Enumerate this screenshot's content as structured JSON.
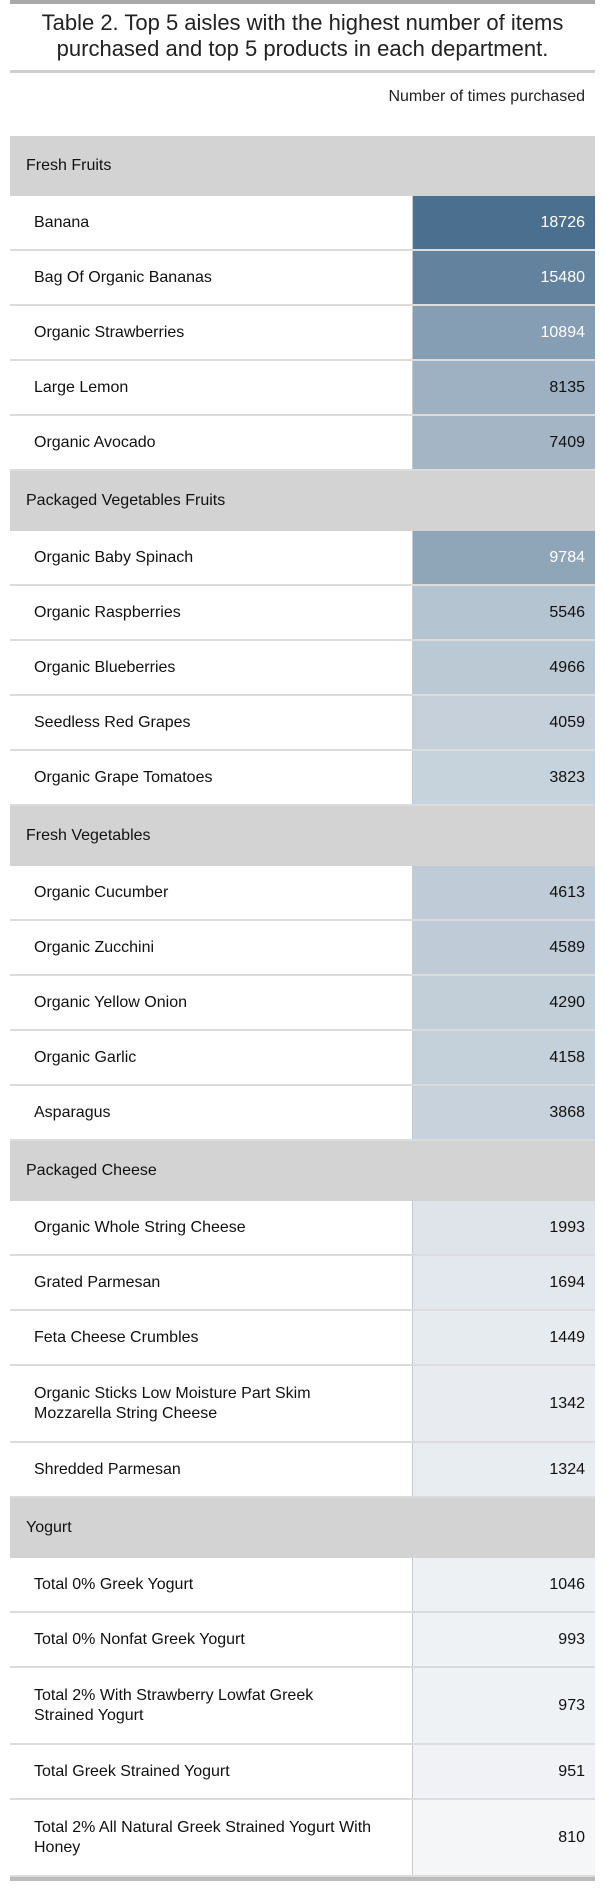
{
  "chart_data": {
    "type": "table",
    "title": "Table 2. Top 5 aisles with the highest number of items purchased and top 5 products in each department.",
    "value_header": "Number of times purchased",
    "value_min": 810,
    "value_max": 18726,
    "colors": {
      "low": "#f4f6f8",
      "high": "#4a6f8f",
      "group_band": "#d3d3d3"
    },
    "groups": [
      {
        "name": "Fresh Fruits",
        "rows": [
          {
            "product": "Banana",
            "value": 18726
          },
          {
            "product": "Bag Of Organic Bananas",
            "value": 15480
          },
          {
            "product": "Organic Strawberries",
            "value": 10894
          },
          {
            "product": "Large Lemon",
            "value": 8135
          },
          {
            "product": "Organic Avocado",
            "value": 7409
          }
        ]
      },
      {
        "name": "Packaged Vegetables Fruits",
        "rows": [
          {
            "product": "Organic Baby Spinach",
            "value": 9784
          },
          {
            "product": "Organic Raspberries",
            "value": 5546
          },
          {
            "product": "Organic Blueberries",
            "value": 4966
          },
          {
            "product": "Seedless Red Grapes",
            "value": 4059
          },
          {
            "product": "Organic Grape Tomatoes",
            "value": 3823
          }
        ]
      },
      {
        "name": "Fresh Vegetables",
        "rows": [
          {
            "product": "Organic Cucumber",
            "value": 4613
          },
          {
            "product": "Organic Zucchini",
            "value": 4589
          },
          {
            "product": "Organic Yellow Onion",
            "value": 4290
          },
          {
            "product": "Organic Garlic",
            "value": 4158
          },
          {
            "product": "Asparagus",
            "value": 3868
          }
        ]
      },
      {
        "name": "Packaged Cheese",
        "rows": [
          {
            "product": "Organic Whole String Cheese",
            "value": 1993
          },
          {
            "product": "Grated Parmesan",
            "value": 1694
          },
          {
            "product": "Feta Cheese Crumbles",
            "value": 1449
          },
          {
            "product": "Organic Sticks Low Moisture Part Skim Mozzarella String Cheese",
            "value": 1342
          },
          {
            "product": "Shredded Parmesan",
            "value": 1324
          }
        ]
      },
      {
        "name": "Yogurt",
        "rows": [
          {
            "product": "Total 0% Greek Yogurt",
            "value": 1046
          },
          {
            "product": "Total 0% Nonfat Greek Yogurt",
            "value": 993
          },
          {
            "product": "Total 2% With Strawberry Lowfat Greek Strained Yogurt",
            "value": 973
          },
          {
            "product": "Total Greek Strained Yogurt",
            "value": 951
          },
          {
            "product": "Total 2% All Natural Greek Strained Yogurt With Honey",
            "value": 810
          }
        ]
      }
    ]
  }
}
